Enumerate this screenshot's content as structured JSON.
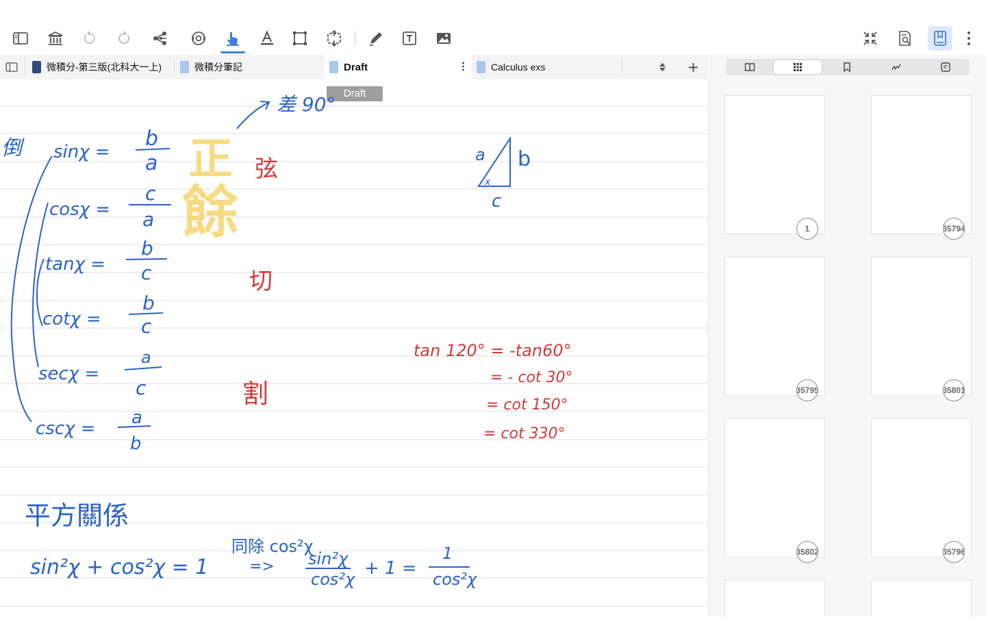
{
  "toolbar": {
    "left_icons": [
      "sidebar-toggle-icon",
      "library-icon",
      "undo-icon",
      "redo-icon",
      "share-icon",
      "sync-icon",
      "pointer-icon",
      "text-color-icon",
      "crop-icon",
      "resize-icon",
      "pen-icon",
      "text-box-icon",
      "image-icon"
    ],
    "right_icons": [
      "collapse-icon",
      "search-document-icon",
      "bookmark-panel-icon",
      "more-icon"
    ],
    "active_tool": "pointer-icon",
    "accent": "#3f7fdc"
  },
  "tabs": [
    {
      "label": "微積分-第三版(北科大一上)",
      "icon_color": "#2f4a7a"
    },
    {
      "label": "微積分筆記",
      "icon_color": "#a9c8ec"
    },
    {
      "label": "Draft",
      "icon_color": "#a9c8ec",
      "active": true
    },
    {
      "label": "Calculus exs",
      "icon_color": "#a9c8ec"
    }
  ],
  "draft_label": "Draft",
  "side_panel": {
    "segments": [
      "two-page-view-icon",
      "grid-icon",
      "bookmark-icon",
      "handwriting-icon",
      "note-icon"
    ],
    "active_segment": "grid-icon",
    "thumbnails": [
      {
        "num": "1"
      },
      {
        "num": "35794"
      },
      {
        "num": "35795"
      },
      {
        "num": "35801"
      },
      {
        "num": "35802"
      },
      {
        "num": "35796"
      },
      {
        "num": ""
      },
      {
        "num": ""
      }
    ]
  },
  "ink": {
    "blue": "#2a62c8",
    "red": "#d23a3a",
    "highlight": "#f5cf5a",
    "lines": [
      "倒",
      "sinχ =",
      "b",
      "a",
      "cosχ =",
      "c",
      "a",
      "tanχ =",
      "b",
      "c",
      "cotχ =",
      "b",
      "c",
      "secχ =",
      "a",
      "c",
      "cscχ =",
      "a",
      "b",
      "差 90°",
      "正",
      "餘",
      "弦",
      "切",
      "割",
      "a",
      "b",
      "c",
      "x",
      "tan 120° = -tan60°",
      "= - cot 30°",
      "= cot 150°",
      "= cot 330°",
      "平方關係",
      "sin²χ + cos²χ = 1",
      "同除 cos²χ",
      "=>",
      "sin²χ",
      "cos²χ",
      "+ 1 =",
      "1",
      "cos²χ",
      "="
    ]
  }
}
